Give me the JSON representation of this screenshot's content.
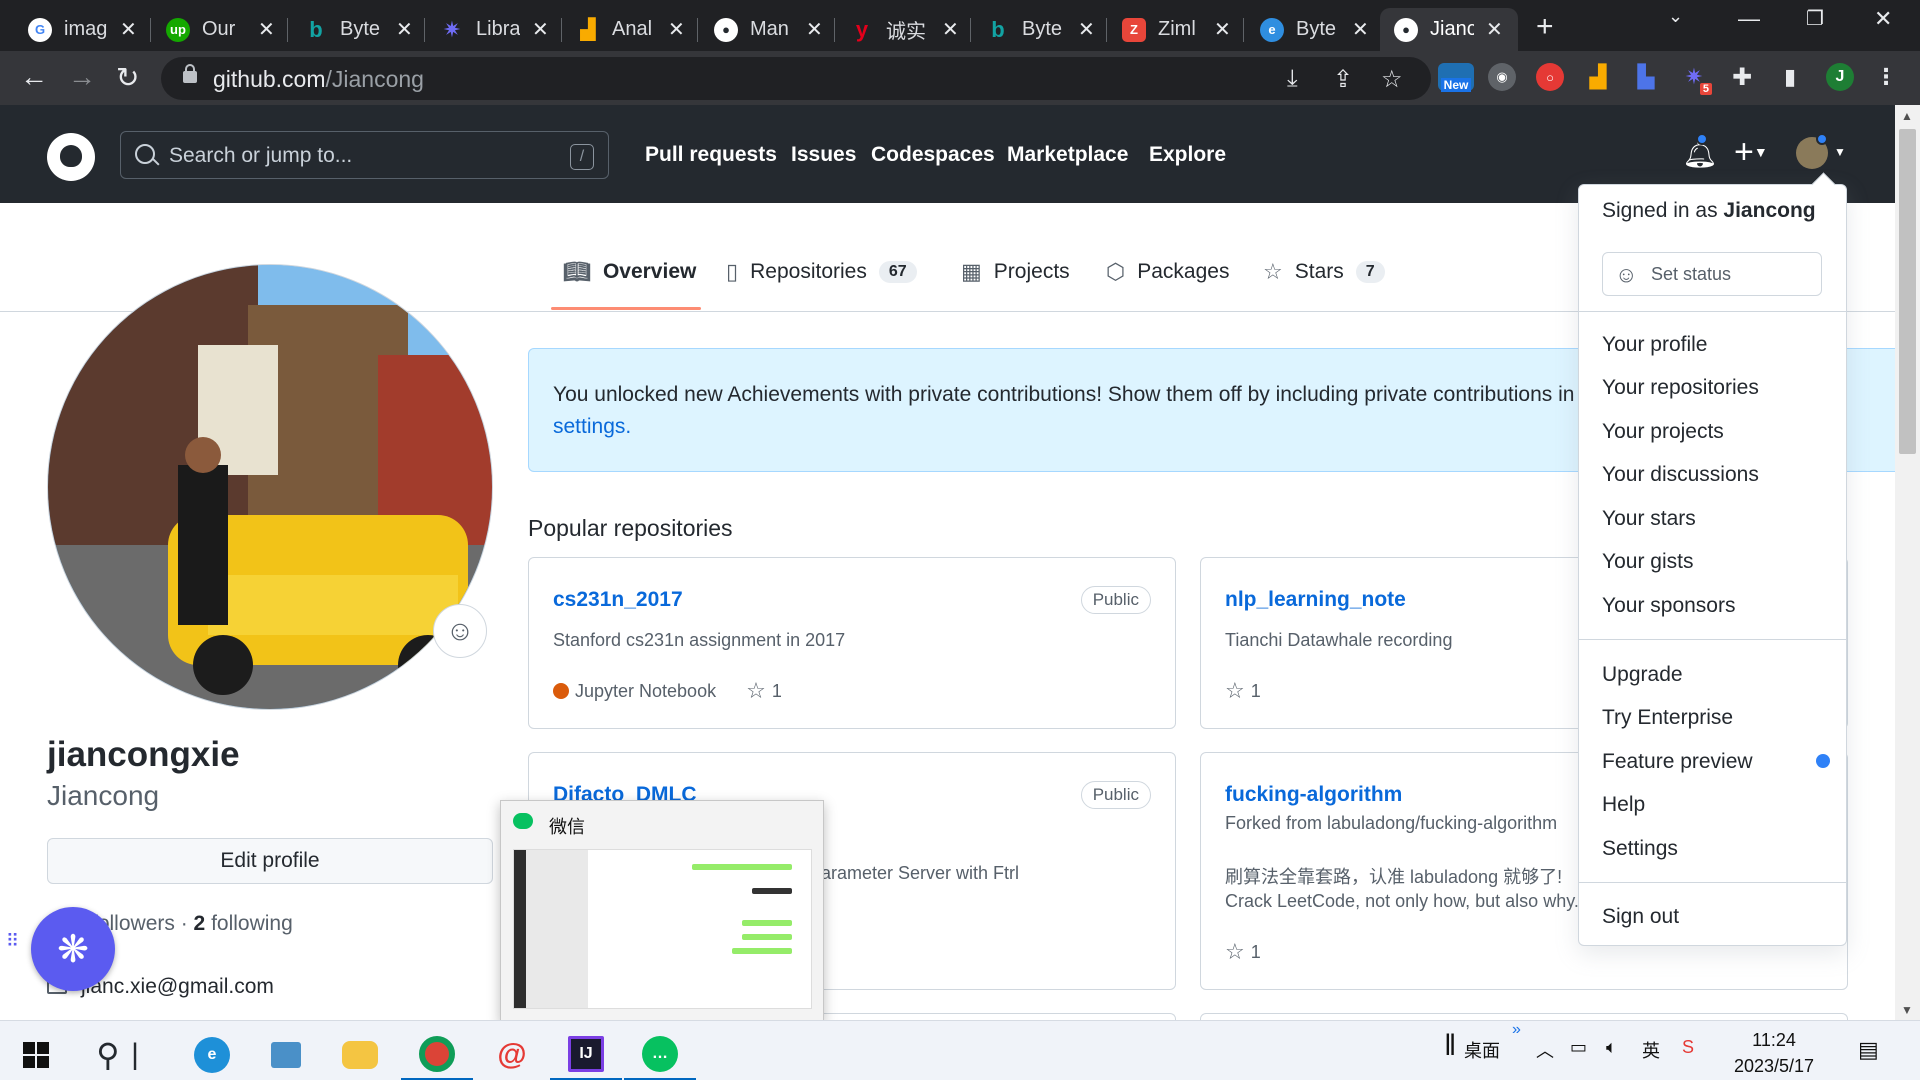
{
  "browser": {
    "tabs": [
      {
        "title": "imag",
        "icon": "google-icon",
        "color": "#ffffff"
      },
      {
        "title": "Our",
        "icon": "upwork-icon",
        "color": "#14a800"
      },
      {
        "title": "Byte",
        "icon": "bing-icon",
        "color": "#12a3a3"
      },
      {
        "title": "Libra",
        "icon": "library-icon",
        "color": "#6f6cf5"
      },
      {
        "title": "Anal",
        "icon": "analytics-icon",
        "color": "#f9ab00"
      },
      {
        "title": "Man",
        "icon": "github-icon",
        "color": "#ffffff"
      },
      {
        "title": "诚实",
        "icon": "youdao-icon",
        "color": "#e3001b"
      },
      {
        "title": "Byte",
        "icon": "bing-icon",
        "color": "#12a3a3"
      },
      {
        "title": "Ziml",
        "icon": "zim-icon",
        "color": "#e8463a"
      },
      {
        "title": "Byte",
        "icon": "edge-icon",
        "color": "#2f8ee0"
      },
      {
        "title": "Jianc",
        "icon": "github-icon",
        "color": "#ffffff"
      }
    ],
    "url_host": "github.com",
    "url_path": "/Jiancong",
    "new_badge": "New",
    "ext_badge": "5",
    "profile_initial": "J"
  },
  "header": {
    "search_placeholder": "Search or jump to...",
    "search_key": "/",
    "nav": [
      "Pull requests",
      "Issues",
      "Codespaces",
      "Marketplace",
      "Explore"
    ]
  },
  "tabs": [
    {
      "label": "Overview",
      "icon": "book-icon"
    },
    {
      "label": "Repositories",
      "count": "67",
      "icon": "repo-icon"
    },
    {
      "label": "Projects",
      "icon": "table-icon"
    },
    {
      "label": "Packages",
      "icon": "package-icon"
    },
    {
      "label": "Stars",
      "count": "7",
      "icon": "star-icon"
    }
  ],
  "profile": {
    "name": "jiancongxie",
    "login": "Jiancong",
    "edit_label": "Edit profile",
    "followers_label": "followers",
    "following_count": "2",
    "following_label": "following",
    "email": "jianc.xie@gmail.com"
  },
  "flash": {
    "line1": "You unlocked new Achievements with private contributions! Show them off by including private contributions in",
    "line2": "settings."
  },
  "popular": {
    "title": "Popular repositories",
    "repos": [
      {
        "name": "cs231n_2017",
        "badge": "Public",
        "desc": "Stanford cs231n assignment in 2017",
        "lang": "Jupyter Notebook",
        "lang_color": "#da5b0b",
        "stars": "1"
      },
      {
        "name": "nlp_learning_note",
        "desc": "Tianchi Datawhale recording",
        "stars": "1"
      },
      {
        "name": "Difacto_DMLC",
        "badge": "Public",
        "desc": "arameter Server with Ftrl"
      },
      {
        "name": "fucking-algorithm",
        "forked": "Forked from labuladong/fucking-algorithm",
        "desc": "刷算法全靠套路，认准 labuladong 就够了!",
        "desc2": "Crack LeetCode, not only how, but also why.",
        "stars": "1"
      }
    ]
  },
  "wechat_preview": {
    "title": "微信"
  },
  "dropdown": {
    "signed_in_prefix": "Signed in as ",
    "user": "Jiancong",
    "set_status": "Set status",
    "group1": [
      "Your profile",
      "Your repositories",
      "Your projects",
      "Your discussions",
      "Your stars",
      "Your gists",
      "Your sponsors"
    ],
    "group2": [
      "Upgrade",
      "Try Enterprise",
      "Feature preview",
      "Help",
      "Settings"
    ],
    "sign_out": "Sign out"
  },
  "taskbar": {
    "desktop_label": "桌面",
    "ime_label": "英",
    "time": "11:24",
    "date": "2023/5/17"
  }
}
